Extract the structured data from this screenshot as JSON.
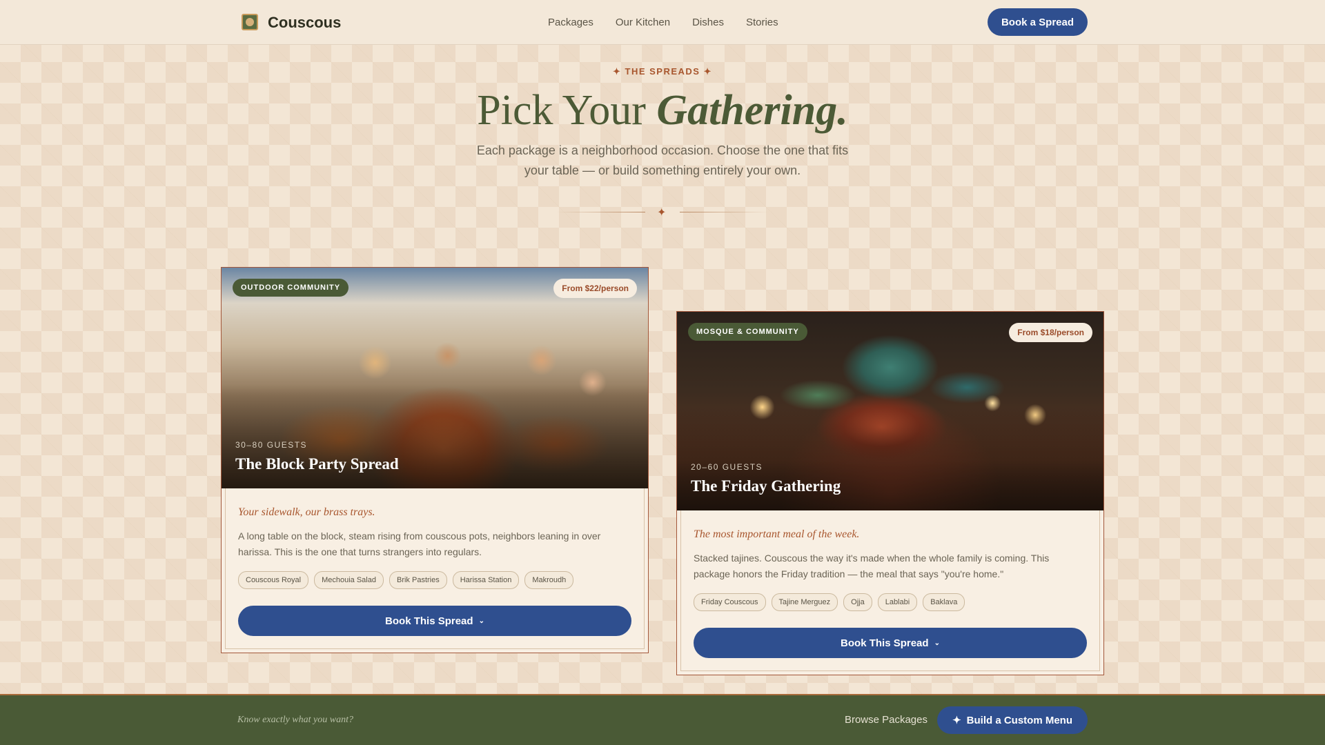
{
  "nav": {
    "brand": "Couscous",
    "links": [
      "Packages",
      "Our Kitchen",
      "Dishes",
      "Stories"
    ],
    "cta": "Book a Spread"
  },
  "hero": {
    "eyebrow": "✦ THE SPREADS ✦",
    "title_plain": "Pick Your ",
    "title_emph": "Gathering.",
    "subtitle": "Each package is a neighborhood occasion. Choose the one that fits your table — or build something entirely your own.",
    "divider_glyph": "✦"
  },
  "cards": [
    {
      "tag": "OUTDOOR COMMUNITY",
      "price": "From $22/person",
      "guests": "30–80 GUESTS",
      "title": "The Block Party Spread",
      "tagline": "Your sidewalk, our brass trays.",
      "description": "A long table on the block, steam rising from couscous pots, neighbors leaning in over harissa. This is the one that turns strangers into regulars.",
      "dishes": [
        "Couscous Royal",
        "Mechouia Salad",
        "Brik Pastries",
        "Harissa Station",
        "Makroudh"
      ],
      "button": "Book This Spread"
    },
    {
      "tag": "MOSQUE & COMMUNITY",
      "price": "From $18/person",
      "guests": "20–60 GUESTS",
      "title": "The Friday Gathering",
      "tagline": "The most important meal of the week.",
      "description": "Stacked tajines. Couscous the way it's made when the whole family is coming. This package honors the Friday tradition — the meal that says \"you're home.\"",
      "dishes": [
        "Friday Couscous",
        "Tajine Merguez",
        "Ojja",
        "Lablabi",
        "Baklava"
      ],
      "button": "Book This Spread"
    }
  ],
  "bottom": {
    "prompt": "Know exactly what you want?",
    "browse": "Browse Packages",
    "custom": "Build a Custom Menu",
    "custom_icon": "✦"
  },
  "icons": {
    "chevron": "chevron-down-icon",
    "sparkle": "sparkle-icon",
    "logo": "couscous-logo"
  },
  "colors": {
    "primary_button": "#2f4f8f",
    "olive": "#4a5a36",
    "terracotta": "#a8562e",
    "cream": "#f3e6d5"
  }
}
